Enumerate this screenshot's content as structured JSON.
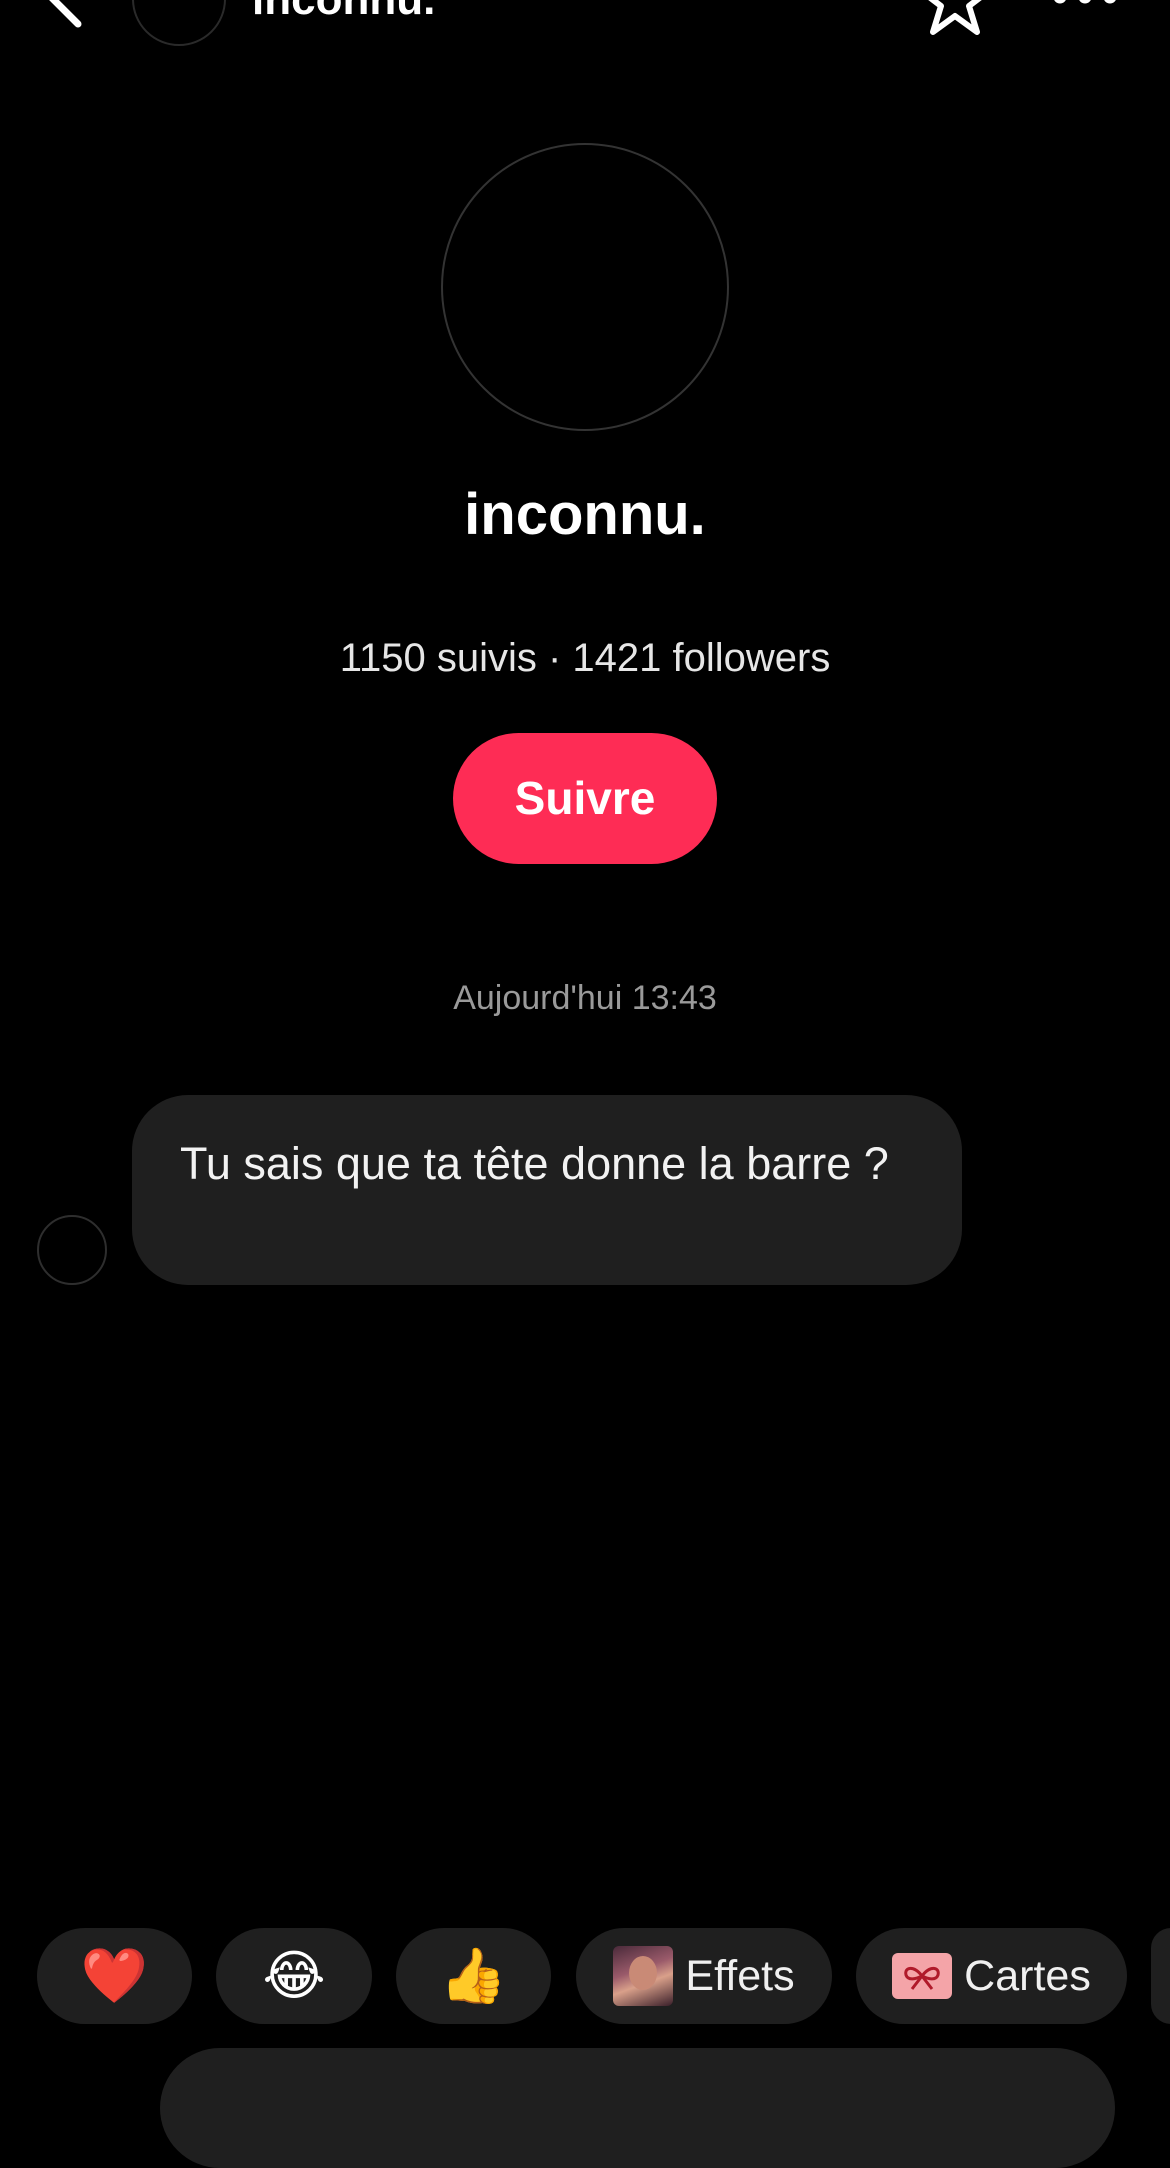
{
  "header": {
    "title": "inconnu."
  },
  "profile": {
    "name": "inconnu.",
    "stats": "1150 suivis · 1421 followers",
    "follow_label": "Suivre"
  },
  "conversation": {
    "timestamp": "Aujourd'hui 13:43",
    "messages": [
      {
        "text": "Tu sais que ta tête donne la barre ?"
      }
    ]
  },
  "quick_reactions": [
    {
      "icon": "heart-emoji",
      "glyph": "❤️"
    },
    {
      "icon": "laughing-tears-emoji",
      "glyph": "😂"
    },
    {
      "icon": "thumbs-up-emoji",
      "glyph": "👍"
    },
    {
      "icon": "effects-thumbnail",
      "label": "Effets"
    },
    {
      "icon": "gift-card-icon",
      "label": "Cartes"
    }
  ],
  "colors": {
    "background": "#000000",
    "accent": "#fe2c55",
    "bubble": "#1f1f1f",
    "muted_text": "#9a9a9a"
  }
}
